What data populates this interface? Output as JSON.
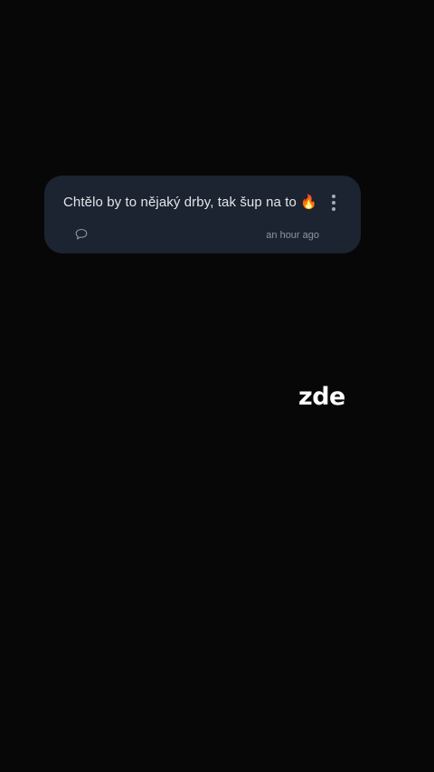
{
  "post": {
    "text": "Chtělo by to nějaký drby, tak šup na to 🔥",
    "timestamp": "an hour ago",
    "comment_icon": "comment-bubble-icon",
    "more_icon": "more-vertical-icon"
  },
  "overlay": {
    "word": "zde"
  },
  "colors": {
    "background": "#070707",
    "card": "#1b2430",
    "text": "#e2e6ea",
    "muted": "#8d96a1"
  }
}
